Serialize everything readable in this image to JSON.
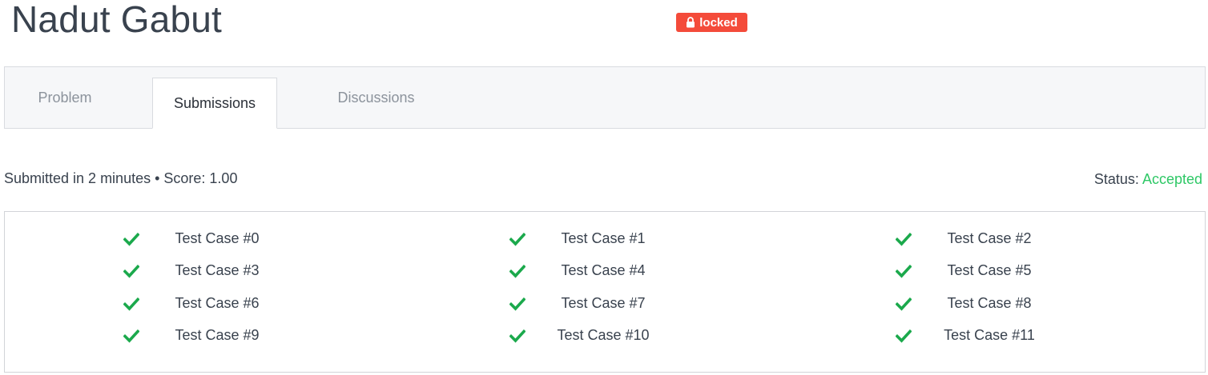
{
  "header": {
    "title": "Nadut Gabut",
    "badge_label": "locked"
  },
  "tabs": [
    {
      "label": "Problem",
      "active": false
    },
    {
      "label": "Submissions",
      "active": true
    },
    {
      "label": "Discussions",
      "active": false
    }
  ],
  "submission": {
    "summary": "Submitted in 2 minutes • Score: 1.00",
    "status_label": "Status:",
    "status_value": "Accepted"
  },
  "test_cases": [
    {
      "label": "Test Case #0",
      "passed": true
    },
    {
      "label": "Test Case #1",
      "passed": true
    },
    {
      "label": "Test Case #2",
      "passed": true
    },
    {
      "label": "Test Case #3",
      "passed": true
    },
    {
      "label": "Test Case #4",
      "passed": true
    },
    {
      "label": "Test Case #5",
      "passed": true
    },
    {
      "label": "Test Case #6",
      "passed": true
    },
    {
      "label": "Test Case #7",
      "passed": true
    },
    {
      "label": "Test Case #8",
      "passed": true
    },
    {
      "label": "Test Case #9",
      "passed": true
    },
    {
      "label": "Test Case #10",
      "passed": true
    },
    {
      "label": "Test Case #11",
      "passed": true
    }
  ],
  "colors": {
    "badge": "#f44b3a",
    "accepted": "#2ec866",
    "check": "#1ba94c"
  },
  "icons": {
    "badge": "lock-icon",
    "test_case": "check-icon"
  }
}
